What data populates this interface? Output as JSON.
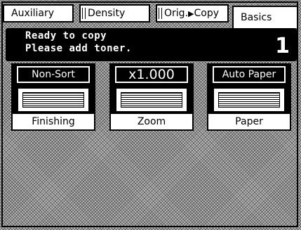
{
  "tabs": [
    {
      "label": "Auxiliary",
      "active": false
    },
    {
      "label": "Density",
      "active": false
    },
    {
      "label": "Orig.",
      "label2": "Copy",
      "active": false
    },
    {
      "label": "Basics",
      "active": true
    }
  ],
  "status": {
    "line1": "Ready to copy",
    "line2": "Please add toner.",
    "count": "1"
  },
  "cards": [
    {
      "value": "Non-Sort",
      "caption": "Finishing"
    },
    {
      "value": "x1.000",
      "caption": "Zoom"
    },
    {
      "value": "Auto Paper",
      "caption": "Paper"
    }
  ],
  "icons": {
    "tab_mark": "tab-mark-icon",
    "arrow": "play-arrow-icon",
    "lines": "lines-icon"
  }
}
